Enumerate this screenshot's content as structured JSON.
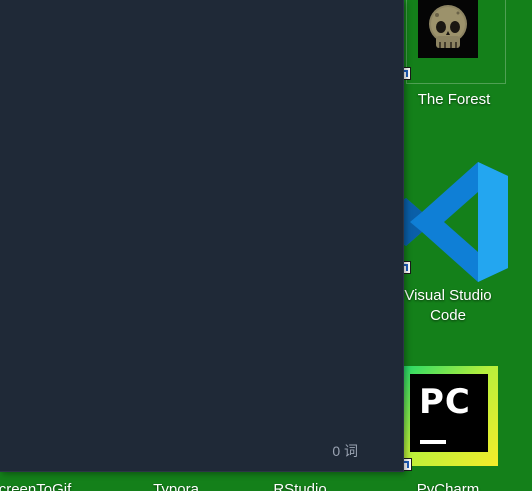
{
  "desktop": {
    "background_color": "#14801a",
    "icons": [
      {
        "label": "The Forest",
        "icon": "skull-game-icon"
      },
      {
        "label": "Visual Studio Code",
        "icon": "vscode-icon"
      },
      {
        "label": "PyCharm",
        "icon": "pycharm-icon",
        "logo_text": "PC"
      },
      {
        "label": "ScreenToGif",
        "icon": "screentogif-icon"
      },
      {
        "label": "Typora",
        "icon": "typora-icon"
      },
      {
        "label": "RStudio",
        "icon": "rstudio-icon"
      }
    ]
  },
  "editor_window": {
    "background_color": "#1f2937",
    "word_count": "0 词"
  }
}
